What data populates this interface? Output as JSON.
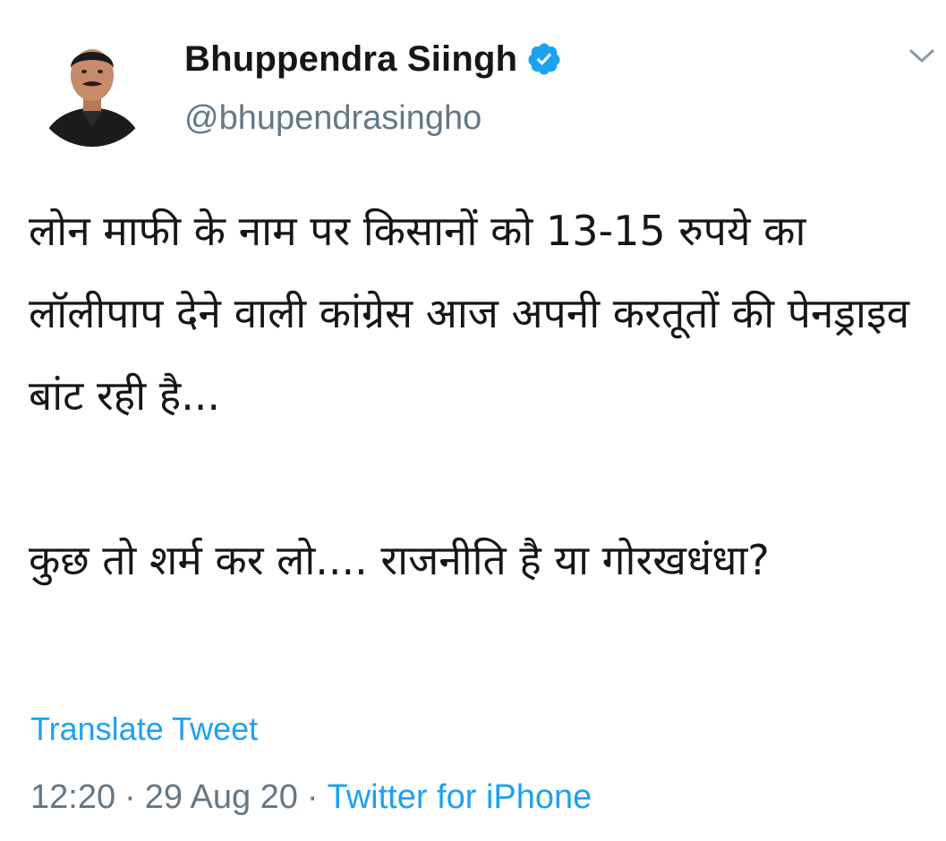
{
  "author": {
    "display_name": "Bhuppendra Siingh",
    "handle": "@bhupendrasingho",
    "verified": true
  },
  "tweet": {
    "paragraph_1": "लोन माफी के नाम पर किसानों को 13-15 रुपये का लॉलीपाप देने वाली कांग्रेस आज अपनी करतूतों की पेनड्राइव बांट रही है...",
    "paragraph_2": "कुछ तो शर्म कर लो.... राजनीति है या गोरखधंधा?"
  },
  "translate_label": "Translate Tweet",
  "meta": {
    "time": "12:20",
    "separator": "·",
    "date": "29 Aug 20",
    "source": "Twitter for iPhone"
  },
  "icons": {
    "verified": "verified-badge-icon",
    "menu": "chevron-down-icon"
  },
  "colors": {
    "link_blue": "#1da1f2",
    "secondary_text": "#657786",
    "primary_text": "#14171a"
  }
}
